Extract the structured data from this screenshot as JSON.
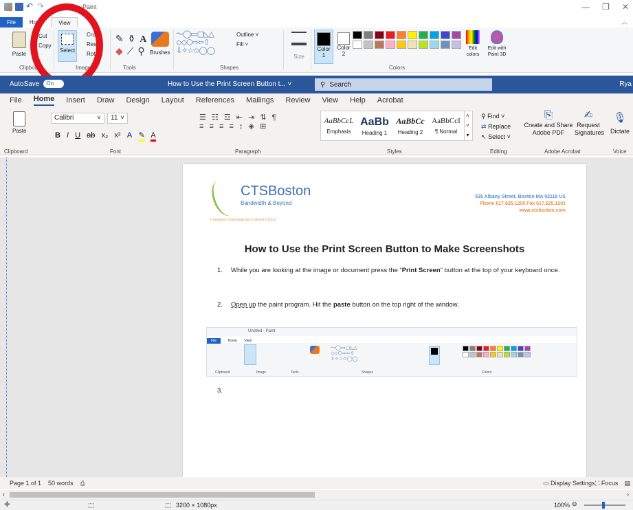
{
  "paint": {
    "title": "Paint",
    "tabs": [
      "File",
      "Home",
      "View"
    ],
    "clipboard": {
      "paste": "Paste",
      "cut": "Cut",
      "copy": "Copy",
      "label": "Clipboard"
    },
    "image": {
      "select": "Select",
      "crop": "Crop",
      "resize": "Resize",
      "rotate": "Rotate",
      "label": "Image"
    },
    "tools": {
      "label": "Tools"
    },
    "brushes": "Brushes",
    "shapes": {
      "label": "Shapes",
      "outline": "Outline",
      "fill": "Fill"
    },
    "size": "Size",
    "color1": {
      "label": "Color",
      "num": "1"
    },
    "color2": {
      "label": "Color",
      "num": "2"
    },
    "colors_label": "Colors",
    "edit_colors": "Edit colors",
    "edit_paint3d": "Edit with Paint 3D",
    "palette": [
      "#000000",
      "#7f7f7f",
      "#880015",
      "#ed1c24",
      "#ff7f27",
      "#fff200",
      "#22b14c",
      "#00a2e8",
      "#3f48cc",
      "#a349a4",
      "#ffffff",
      "#c3c3c3",
      "#b97a57",
      "#ffaec9",
      "#ffc90e",
      "#efe4b0",
      "#b5e61d",
      "#99d9ea",
      "#7092be",
      "#c8bfe7"
    ],
    "dimensions": "3200 × 1080px",
    "zoom": "100%"
  },
  "word": {
    "autosave": "AutoSave",
    "autosave_state": "On",
    "doc_title": "How to Use the Print Screen Button t...",
    "search": "Search",
    "user": "Rya",
    "tabs": [
      "File",
      "Home",
      "Insert",
      "Draw",
      "Design",
      "Layout",
      "References",
      "Mailings",
      "Review",
      "View",
      "Help",
      "Acrobat"
    ],
    "font_name": "Calibri",
    "font_size": "11",
    "styles": [
      {
        "preview": "AaBbCcL",
        "name": "Emphasis"
      },
      {
        "preview": "AaBb",
        "name": "Heading 1"
      },
      {
        "preview": "AaBbCc",
        "name": "Heading 2"
      },
      {
        "preview": "AaBbCcI",
        "name": "¶ Normal"
      }
    ],
    "find": "Find",
    "replace": "Replace",
    "select": "Select",
    "share_pdf": "Create and Share Adobe PDF",
    "request_sig": "Request Signatures",
    "dictate": "Dictate",
    "group_labels": {
      "clipboard": "Clipboard",
      "font": "Font",
      "paragraph": "Paragraph",
      "styles": "Styles",
      "editing": "Editing",
      "acrobat": "Adobe Acrobat",
      "voice": "Voice"
    },
    "paste": "Paste",
    "status": {
      "page": "Page 1 of 1",
      "words": "50 words",
      "display": "Display Settings",
      "focus": "Focus"
    }
  },
  "document": {
    "logo_name": "CTSBoston",
    "logo_tag": "Bandwidth & Beyond",
    "logo_tagline": "Compute.Communicate.Connect.Cloud",
    "address": "535 Albany Street, Boston MA 02118 US",
    "phone": "Phone 617.625.1200 Fax 617.625.1201",
    "web": "www.ctsboston.com",
    "heading": "How to Use the Print Screen Button to Make Screenshots",
    "step1_pre": "While you are looking at the image or document press the “",
    "step1_bold": "Print Screen",
    "step1_post": "” button at the top of your keyboard once.",
    "step2_link": "Open up",
    "step2_pre": " the paint program.  Hit the ",
    "step2_bold": "paste",
    "step2_post": " button on the top right of the window.",
    "step3": "3.",
    "embedded_title": "Untitled - Paint"
  }
}
